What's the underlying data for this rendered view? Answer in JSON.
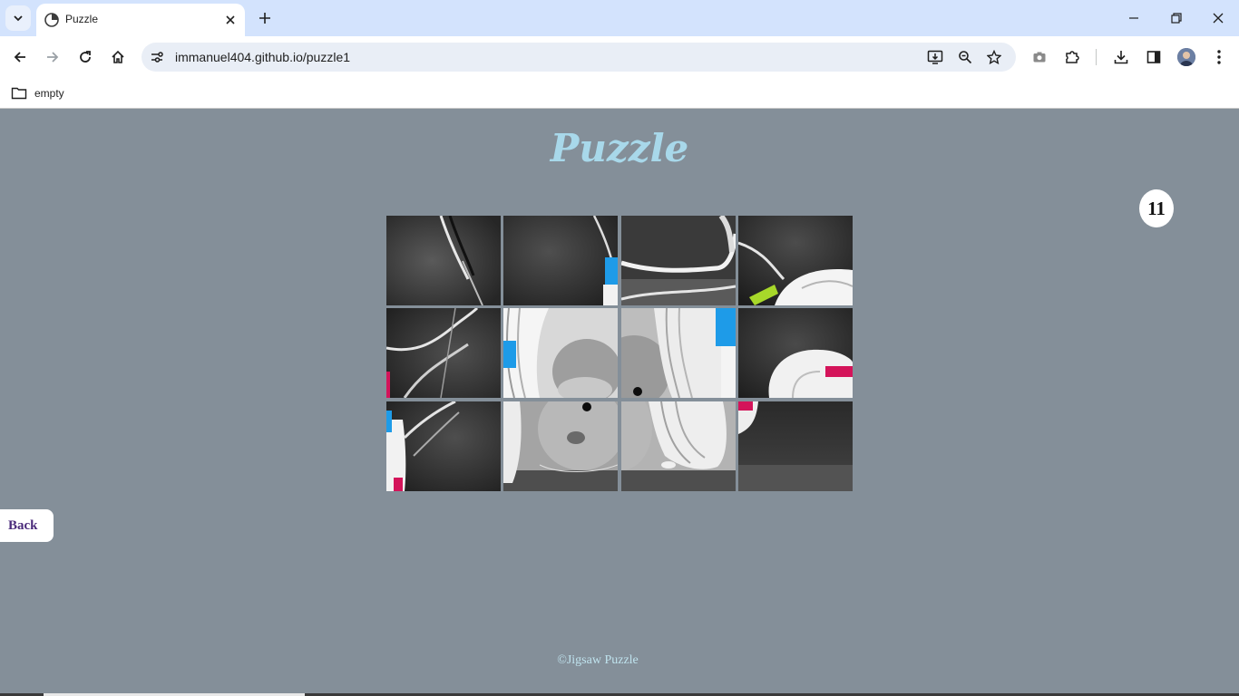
{
  "browser": {
    "tab_title": "Puzzle",
    "url": "immanuel404.github.io/puzzle1",
    "bookmark_folder": "empty",
    "icons": {
      "tab_search": "chevron-down-icon",
      "favicon": "puzzle-favicon-icon",
      "tab_close": "close-icon",
      "new_tab": "plus-icon",
      "minimize": "minimize-icon",
      "restore": "restore-icon",
      "close_window": "close-icon",
      "back": "arrow-left-icon",
      "forward": "arrow-right-icon",
      "reload": "reload-icon",
      "home": "home-icon",
      "site_info": "tune-icon",
      "install": "install-app-icon",
      "zoom": "zoom-icon",
      "bookmark_star": "star-icon",
      "camera": "camera-icon",
      "extensions": "puzzle-piece-icon",
      "downloads": "download-icon",
      "side_panel": "side-panel-icon",
      "profile": "avatar-icon",
      "menu": "kebab-menu-icon"
    }
  },
  "page": {
    "title": "Puzzle",
    "move_count": "11",
    "back_label": "Back",
    "footer": "©Jigsaw Puzzle",
    "background_color": "#848f99",
    "title_color": "#a8d8ea",
    "board": {
      "rows": 3,
      "cols": 4,
      "image_subject": "grayscale hamster with headphones",
      "tiles": [
        {
          "piece": "tile-1"
        },
        {
          "piece": "tile-2"
        },
        {
          "piece": "tile-3"
        },
        {
          "piece": "tile-4"
        },
        {
          "piece": "tile-5"
        },
        {
          "piece": "tile-6"
        },
        {
          "piece": "tile-7"
        },
        {
          "piece": "tile-8"
        },
        {
          "piece": "tile-9"
        },
        {
          "piece": "tile-10"
        },
        {
          "piece": "tile-11"
        },
        {
          "piece": "tile-12"
        }
      ]
    }
  }
}
